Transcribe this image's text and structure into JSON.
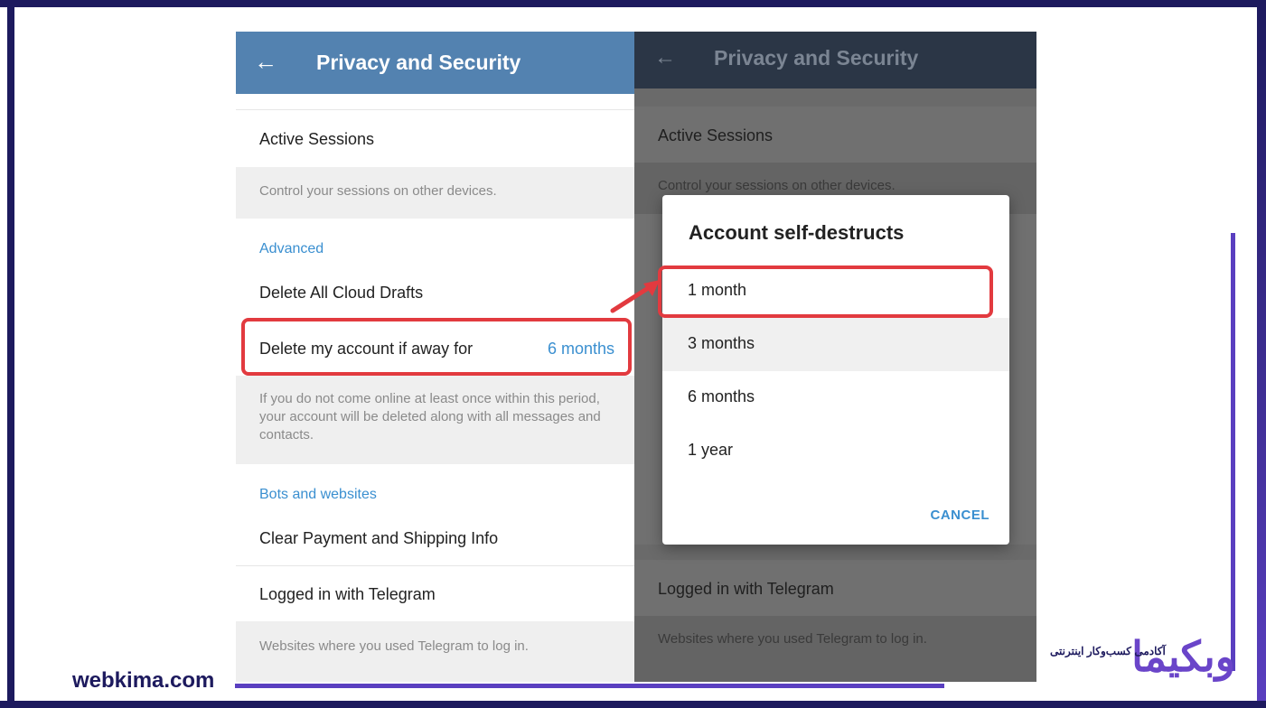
{
  "left_screen": {
    "header": {
      "back_icon": "arrow-left-icon",
      "title": "Privacy and Security"
    },
    "active_sessions": {
      "label": "Active Sessions",
      "note": "Control your sessions on other devices."
    },
    "advanced": {
      "section_title": "Advanced",
      "delete_drafts_label": "Delete All Cloud Drafts",
      "delete_account_label": "Delete my account if away for",
      "delete_account_value": "6 months",
      "delete_account_note": "If you do not come online at least once within this period, your account will be deleted along with all messages and contacts."
    },
    "bots": {
      "section_title": "Bots and websites",
      "clear_payment_label": "Clear Payment and Shipping Info",
      "logged_in_label": "Logged in with Telegram",
      "logged_in_note": "Websites where you used Telegram to log in."
    }
  },
  "right_screen": {
    "header": {
      "back_icon": "arrow-left-icon",
      "title": "Privacy and Security"
    },
    "active_sessions_label": "Active Sessions",
    "active_sessions_note": "Control your sessions on other devices.",
    "logged_in_label": "Logged in with Telegram",
    "logged_in_note": "Websites where you used Telegram to log in.",
    "dialog": {
      "title": "Account self-destructs",
      "options": [
        "1 month",
        "3 months",
        "6 months",
        "1 year"
      ],
      "cancel_label": "CANCEL"
    }
  },
  "branding": {
    "site": "webkima.com",
    "logo_latin": "وبکیما",
    "logo_tagline": "آکادمی کسب‌وکار اینترنتی"
  },
  "colors": {
    "header_blue": "#5382b0",
    "accent_blue": "#3a8fd0",
    "highlight_red": "#e23a3f",
    "brand_purple": "#5a3fc0"
  }
}
